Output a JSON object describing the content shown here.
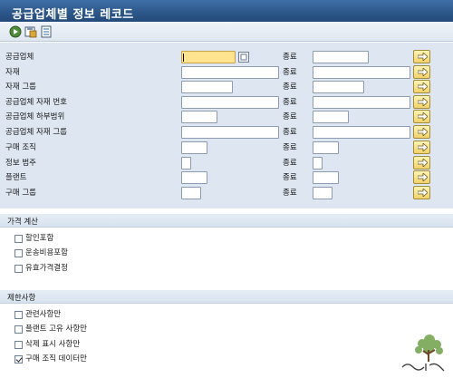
{
  "window": {
    "title": "공급업체별 정보 레코드"
  },
  "toolbar": {
    "buttons": [
      {
        "icon": "execute-icon"
      },
      {
        "icon": "save-variant-icon"
      },
      {
        "icon": "selection-options-icon"
      }
    ]
  },
  "selection": {
    "range_label": "종료",
    "rows": [
      {
        "label": "공급업체",
        "value": ""
      },
      {
        "label": "자재",
        "value": ""
      },
      {
        "label": "자재 그룹",
        "value": ""
      },
      {
        "label": "공급업체 자재 번호",
        "value": ""
      },
      {
        "label": "공급업체 하부범위",
        "value": ""
      },
      {
        "label": "공급업체 자재 그룹",
        "value": ""
      },
      {
        "label": "구매 조직",
        "value": ""
      },
      {
        "label": "정보 범주",
        "value": ""
      },
      {
        "label": "플랜트",
        "value": ""
      },
      {
        "label": "구매 그룹",
        "value": ""
      }
    ]
  },
  "pricing": {
    "title": "가격 계산",
    "options": [
      {
        "label": "할인포함",
        "checked": false
      },
      {
        "label": "운송비용포함",
        "checked": false
      },
      {
        "label": "유효가격결정",
        "checked": false
      }
    ]
  },
  "restrictions": {
    "title": "제한사항",
    "options": [
      {
        "label": "관련사항만",
        "checked": false
      },
      {
        "label": "플랜트 고유 사항만",
        "checked": false
      },
      {
        "label": "삭제 표시 사항만",
        "checked": false
      },
      {
        "label": "구매 조직 데이터만",
        "checked": true
      }
    ]
  },
  "colors": {
    "titlebar": "#2c5689",
    "selection_bg": "#dde6f1",
    "focused_field": "#ffe38f",
    "multi_select_button": "#f2d26a"
  }
}
